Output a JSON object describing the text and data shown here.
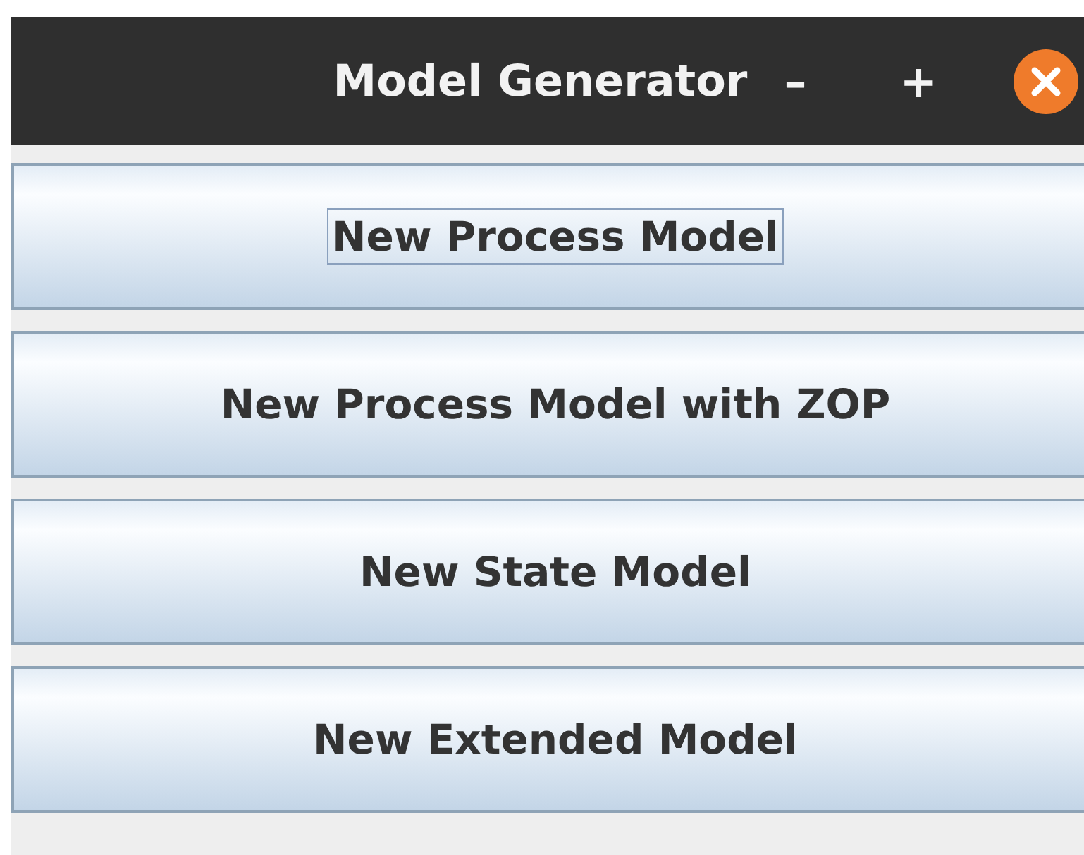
{
  "window": {
    "title": "Model Generator",
    "controls": [
      {
        "kind": "minimize",
        "label": "–"
      },
      {
        "kind": "maximize",
        "label": "+"
      },
      {
        "kind": "close"
      }
    ]
  },
  "buttons": [
    {
      "label": "New Process Model",
      "focused": true
    },
    {
      "label": "New Process Model with ZOP",
      "focused": false
    },
    {
      "label": "New State Model",
      "focused": false
    },
    {
      "label": "New Extended Model",
      "focused": false
    }
  ]
}
